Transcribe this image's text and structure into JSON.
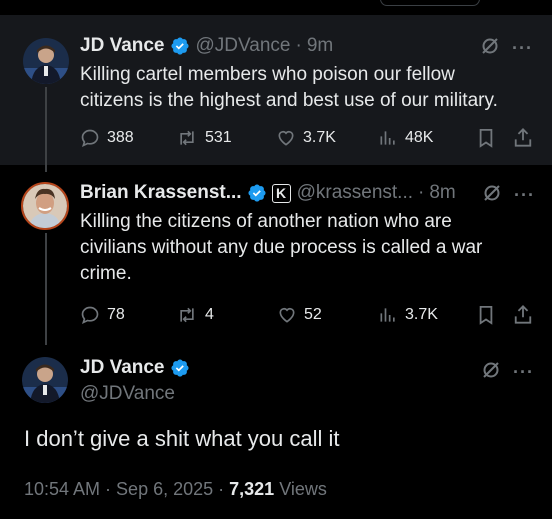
{
  "tweets": [
    {
      "name": "JD Vance",
      "handle": "@JDVance",
      "time": "9m",
      "text_lines": [
        "Killing cartel members who poison our fellow",
        "citizens is the highest and best use of our military."
      ],
      "replies": "388",
      "reposts": "531",
      "likes": "3.7K",
      "views": "48K"
    },
    {
      "name": "Brian Krassenst...",
      "handle": "@krassenst...",
      "time": "8m",
      "text_lines": [
        "Killing the citizens of another nation who are",
        "civilians without any due process is called a war",
        "crime."
      ],
      "replies": "78",
      "reposts": "4",
      "likes": "52",
      "views": "3.7K"
    }
  ],
  "main_tweet": {
    "name": "JD Vance",
    "handle": "@JDVance",
    "text": "I don’t give a shit what you call it",
    "time": "10:54 AM · Sep 6, 2025 · ",
    "views_count": "7,321",
    "views_label": " Views"
  },
  "icons": {
    "more": "···",
    "affiliate_badge": "K"
  },
  "colors": {
    "verified": "#1d9bf0",
    "muted": "#71767b",
    "text": "#e7e9ea",
    "highlight_bg": "#16181c"
  }
}
